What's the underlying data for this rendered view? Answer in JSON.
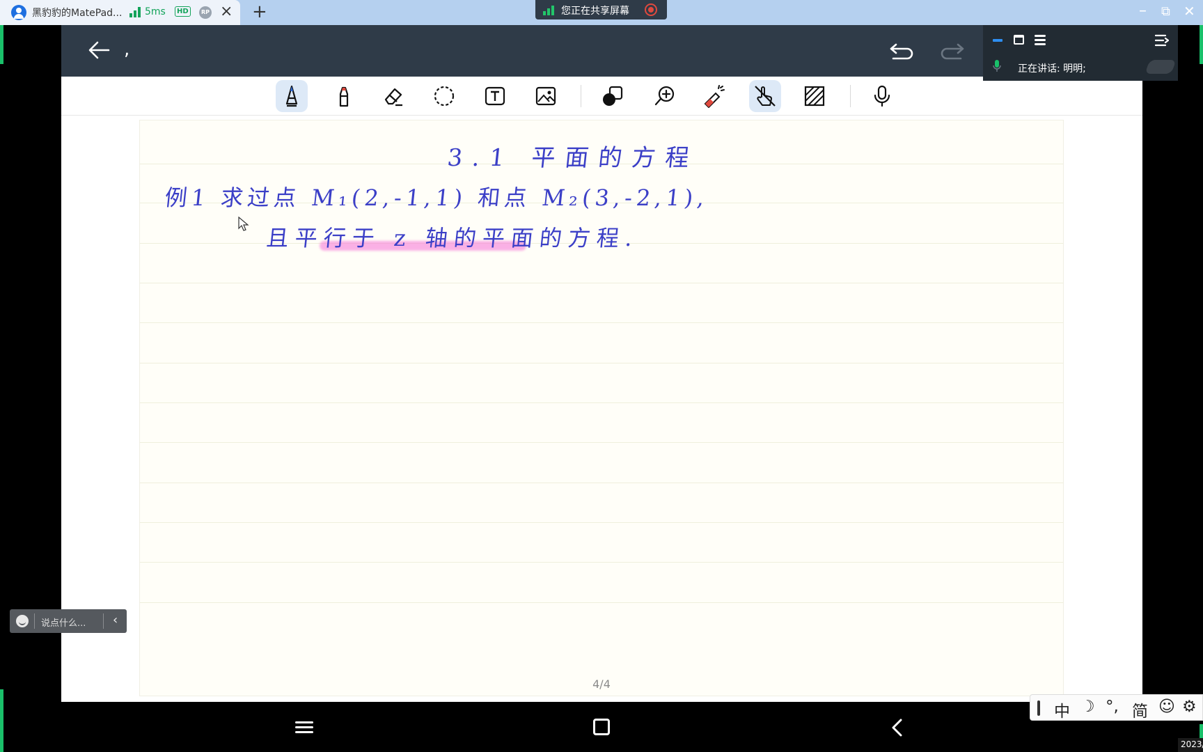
{
  "browser": {
    "tab_title": "黑豹豹的MatePad...",
    "ping": "5ms",
    "hd_badge": "HD",
    "rp_badge": "RP",
    "close_glyph": "×",
    "new_tab_glyph": "+",
    "window_controls": [
      "–",
      "⧉",
      "✕"
    ]
  },
  "share_banner": {
    "text": "您正在共享屏幕"
  },
  "note_app": {
    "doc_title": ",",
    "toolbar": {
      "tools": [
        "pen-icon",
        "marker-icon",
        "eraser-icon",
        "lasso-icon",
        "text-box-icon",
        "image-icon",
        "shapes-icon",
        "zoom-icon",
        "laser-pointer-icon",
        "hand-draw-icon",
        "pattern-fill-icon",
        "microphone-icon"
      ],
      "active": [
        "pen-icon",
        "hand-draw-icon"
      ]
    },
    "page": {
      "heading": "3.1 平面的方程",
      "line1": "例1  求过点 M₁(2,-1,1) 和点 M₂(3,-2,1),",
      "line2": "且平行于 z 轴的平面的方程.",
      "page_indicator": "4/4"
    },
    "ink_color": "#3b3fc7",
    "highlight_color": "#f670d6"
  },
  "speaker_panel": {
    "label": "正在讲话:  明明;"
  },
  "chat": {
    "placeholder": "说点什么...",
    "collapse_glyph": "‹"
  },
  "ime": {
    "chinese": "中",
    "moon": "☽",
    "punct": "°,",
    "simplified": "简",
    "emoji": "☺",
    "settings": "⚙"
  },
  "clock_stub": "2023/"
}
